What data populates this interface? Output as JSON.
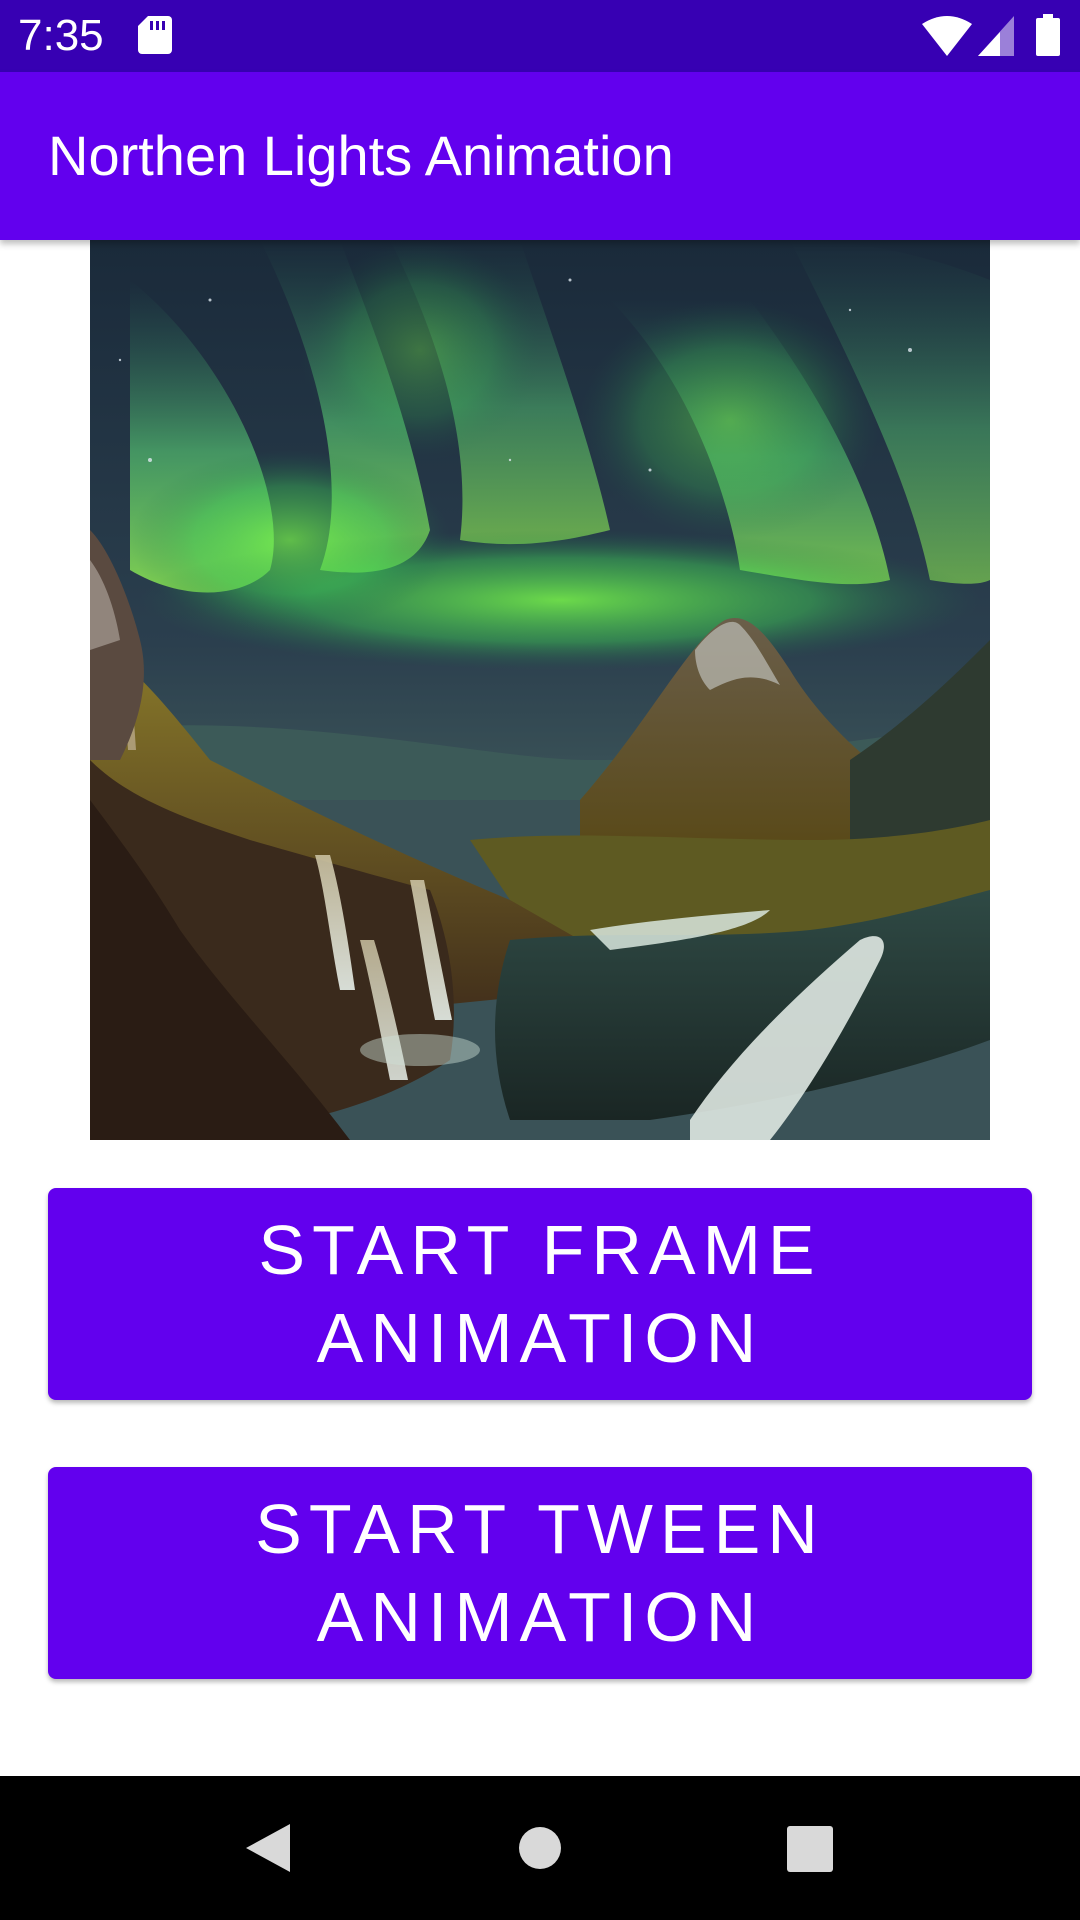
{
  "status_bar": {
    "time": "7:35",
    "icons": [
      "sd-card-icon",
      "wifi-icon",
      "signal-icon",
      "battery-icon"
    ],
    "background": "#3700b3"
  },
  "app_bar": {
    "title": "Northen Lights Animation",
    "background": "#6200ee"
  },
  "image": {
    "subject": "northern-lights-over-mountain-and-waterfall"
  },
  "buttons": {
    "frame_label": "START FRAME ANIMATION",
    "tween_label": "START TWEEN ANIMATION",
    "background": "#6200ee",
    "text_color": "#ffffff"
  },
  "nav_bar": {
    "icons": [
      "back-icon",
      "home-icon",
      "recents-icon"
    ],
    "background": "#000000"
  }
}
